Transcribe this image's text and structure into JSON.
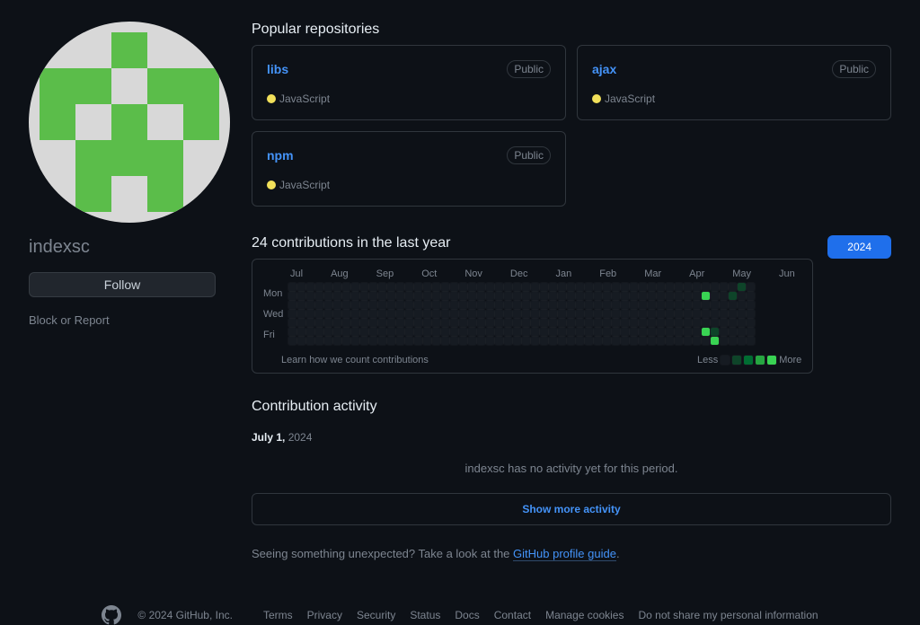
{
  "profile": {
    "username": "indexsc",
    "follow_label": "Follow",
    "block_report": "Block or Report"
  },
  "popular": {
    "heading": "Popular repositories",
    "repos": [
      {
        "name": "libs",
        "visibility": "Public",
        "lang": "JavaScript",
        "lang_color": "#f1e05a"
      },
      {
        "name": "ajax",
        "visibility": "Public",
        "lang": "JavaScript",
        "lang_color": "#f1e05a"
      },
      {
        "name": "npm",
        "visibility": "Public",
        "lang": "JavaScript",
        "lang_color": "#f1e05a"
      }
    ]
  },
  "contrib": {
    "heading": "24 contributions in the last year",
    "year_button": "2024",
    "months": [
      "Jul",
      "Aug",
      "Sep",
      "Oct",
      "Nov",
      "Dec",
      "Jan",
      "Feb",
      "Mar",
      "Apr",
      "May",
      "Jun"
    ],
    "day_labels": [
      "Mon",
      "Wed",
      "Fri"
    ],
    "learn_link": "Learn how we count contributions",
    "legend_less": "Less",
    "legend_more": "More",
    "highlights": [
      {
        "week": 46,
        "day": 1,
        "level": 4
      },
      {
        "week": 46,
        "day": 5,
        "level": 4
      },
      {
        "week": 47,
        "day": 5,
        "level": 1
      },
      {
        "week": 47,
        "day": 6,
        "level": 4
      },
      {
        "week": 49,
        "day": 1,
        "level": 1
      },
      {
        "week": 50,
        "day": 0,
        "level": 1
      }
    ],
    "total_weeks": 52
  },
  "activity": {
    "heading": "Contribution activity",
    "date_strong": "July 1,",
    "date_dim": "2024",
    "empty_msg": "indexsc has no activity yet for this period.",
    "show_more": "Show more activity",
    "hint_pre": "Seeing something unexpected? Take a look at the ",
    "hint_link": "GitHub profile guide",
    "hint_post": "."
  },
  "footer": {
    "copyright": "© 2024 GitHub, Inc.",
    "links": [
      "Terms",
      "Privacy",
      "Security",
      "Status",
      "Docs",
      "Contact",
      "Manage cookies",
      "Do not share my personal information"
    ]
  }
}
